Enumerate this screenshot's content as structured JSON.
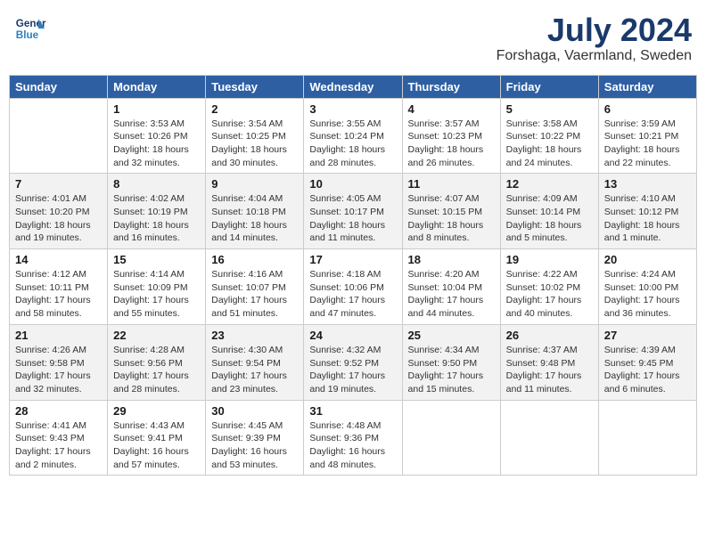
{
  "header": {
    "logo_line1": "General",
    "logo_line2": "Blue",
    "month_year": "July 2024",
    "location": "Forshaga, Vaermland, Sweden"
  },
  "days_of_week": [
    "Sunday",
    "Monday",
    "Tuesday",
    "Wednesday",
    "Thursday",
    "Friday",
    "Saturday"
  ],
  "weeks": [
    [
      {
        "day": "",
        "detail": ""
      },
      {
        "day": "1",
        "detail": "Sunrise: 3:53 AM\nSunset: 10:26 PM\nDaylight: 18 hours\nand 32 minutes."
      },
      {
        "day": "2",
        "detail": "Sunrise: 3:54 AM\nSunset: 10:25 PM\nDaylight: 18 hours\nand 30 minutes."
      },
      {
        "day": "3",
        "detail": "Sunrise: 3:55 AM\nSunset: 10:24 PM\nDaylight: 18 hours\nand 28 minutes."
      },
      {
        "day": "4",
        "detail": "Sunrise: 3:57 AM\nSunset: 10:23 PM\nDaylight: 18 hours\nand 26 minutes."
      },
      {
        "day": "5",
        "detail": "Sunrise: 3:58 AM\nSunset: 10:22 PM\nDaylight: 18 hours\nand 24 minutes."
      },
      {
        "day": "6",
        "detail": "Sunrise: 3:59 AM\nSunset: 10:21 PM\nDaylight: 18 hours\nand 22 minutes."
      }
    ],
    [
      {
        "day": "7",
        "detail": "Sunrise: 4:01 AM\nSunset: 10:20 PM\nDaylight: 18 hours\nand 19 minutes."
      },
      {
        "day": "8",
        "detail": "Sunrise: 4:02 AM\nSunset: 10:19 PM\nDaylight: 18 hours\nand 16 minutes."
      },
      {
        "day": "9",
        "detail": "Sunrise: 4:04 AM\nSunset: 10:18 PM\nDaylight: 18 hours\nand 14 minutes."
      },
      {
        "day": "10",
        "detail": "Sunrise: 4:05 AM\nSunset: 10:17 PM\nDaylight: 18 hours\nand 11 minutes."
      },
      {
        "day": "11",
        "detail": "Sunrise: 4:07 AM\nSunset: 10:15 PM\nDaylight: 18 hours\nand 8 minutes."
      },
      {
        "day": "12",
        "detail": "Sunrise: 4:09 AM\nSunset: 10:14 PM\nDaylight: 18 hours\nand 5 minutes."
      },
      {
        "day": "13",
        "detail": "Sunrise: 4:10 AM\nSunset: 10:12 PM\nDaylight: 18 hours\nand 1 minute."
      }
    ],
    [
      {
        "day": "14",
        "detail": "Sunrise: 4:12 AM\nSunset: 10:11 PM\nDaylight: 17 hours\nand 58 minutes."
      },
      {
        "day": "15",
        "detail": "Sunrise: 4:14 AM\nSunset: 10:09 PM\nDaylight: 17 hours\nand 55 minutes."
      },
      {
        "day": "16",
        "detail": "Sunrise: 4:16 AM\nSunset: 10:07 PM\nDaylight: 17 hours\nand 51 minutes."
      },
      {
        "day": "17",
        "detail": "Sunrise: 4:18 AM\nSunset: 10:06 PM\nDaylight: 17 hours\nand 47 minutes."
      },
      {
        "day": "18",
        "detail": "Sunrise: 4:20 AM\nSunset: 10:04 PM\nDaylight: 17 hours\nand 44 minutes."
      },
      {
        "day": "19",
        "detail": "Sunrise: 4:22 AM\nSunset: 10:02 PM\nDaylight: 17 hours\nand 40 minutes."
      },
      {
        "day": "20",
        "detail": "Sunrise: 4:24 AM\nSunset: 10:00 PM\nDaylight: 17 hours\nand 36 minutes."
      }
    ],
    [
      {
        "day": "21",
        "detail": "Sunrise: 4:26 AM\nSunset: 9:58 PM\nDaylight: 17 hours\nand 32 minutes."
      },
      {
        "day": "22",
        "detail": "Sunrise: 4:28 AM\nSunset: 9:56 PM\nDaylight: 17 hours\nand 28 minutes."
      },
      {
        "day": "23",
        "detail": "Sunrise: 4:30 AM\nSunset: 9:54 PM\nDaylight: 17 hours\nand 23 minutes."
      },
      {
        "day": "24",
        "detail": "Sunrise: 4:32 AM\nSunset: 9:52 PM\nDaylight: 17 hours\nand 19 minutes."
      },
      {
        "day": "25",
        "detail": "Sunrise: 4:34 AM\nSunset: 9:50 PM\nDaylight: 17 hours\nand 15 minutes."
      },
      {
        "day": "26",
        "detail": "Sunrise: 4:37 AM\nSunset: 9:48 PM\nDaylight: 17 hours\nand 11 minutes."
      },
      {
        "day": "27",
        "detail": "Sunrise: 4:39 AM\nSunset: 9:45 PM\nDaylight: 17 hours\nand 6 minutes."
      }
    ],
    [
      {
        "day": "28",
        "detail": "Sunrise: 4:41 AM\nSunset: 9:43 PM\nDaylight: 17 hours\nand 2 minutes."
      },
      {
        "day": "29",
        "detail": "Sunrise: 4:43 AM\nSunset: 9:41 PM\nDaylight: 16 hours\nand 57 minutes."
      },
      {
        "day": "30",
        "detail": "Sunrise: 4:45 AM\nSunset: 9:39 PM\nDaylight: 16 hours\nand 53 minutes."
      },
      {
        "day": "31",
        "detail": "Sunrise: 4:48 AM\nSunset: 9:36 PM\nDaylight: 16 hours\nand 48 minutes."
      },
      {
        "day": "",
        "detail": ""
      },
      {
        "day": "",
        "detail": ""
      },
      {
        "day": "",
        "detail": ""
      }
    ]
  ]
}
